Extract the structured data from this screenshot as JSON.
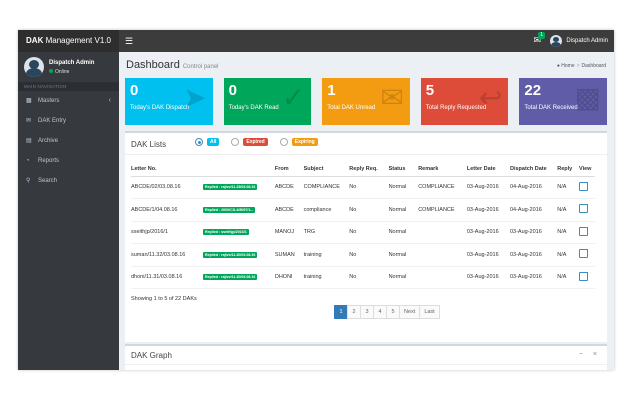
{
  "app": {
    "title_bold": "DAK",
    "title_rest": " Management V1.0"
  },
  "topbar": {
    "mail_count": "1",
    "user": "Dispatch Admin"
  },
  "sidebar": {
    "user_name": "Dispatch Admin",
    "status": "Online",
    "header": "MAIN NAVIGATION",
    "items": [
      {
        "label": "Masters",
        "icon": "dashboard-icon"
      },
      {
        "label": "DAK Entry",
        "icon": "envelope-icon"
      },
      {
        "label": "Archive",
        "icon": "archive-icon"
      },
      {
        "label": "Reports",
        "icon": "pie-chart-icon"
      },
      {
        "label": "Search",
        "icon": "search-icon"
      }
    ]
  },
  "page": {
    "title": "Dashboard",
    "subtitle": "Control panel",
    "breadcrumb_home": "Home",
    "breadcrumb_current": "Dashboard"
  },
  "stats": [
    {
      "value": "0",
      "label": "Today's DAK Dispatch",
      "color": "#00c0ef",
      "icon": "paper-plane-icon"
    },
    {
      "value": "0",
      "label": "Today's DAK Read",
      "color": "#00a65a",
      "icon": "check-icon"
    },
    {
      "value": "1",
      "label": "Total DAK Unread",
      "color": "#f39c12",
      "icon": "envelope-icon"
    },
    {
      "value": "5",
      "label": "Total Reply Requested",
      "color": "#dd4b39",
      "icon": "reply-icon"
    },
    {
      "value": "22",
      "label": "Total DAK Received",
      "color": "#605ca8",
      "icon": "chat-icon"
    }
  ],
  "lists": {
    "title": "DAK Lists",
    "filters": {
      "all": "All",
      "expired": "Expired",
      "expiring": "Expiring"
    },
    "columns": [
      "Letter No.",
      "From",
      "Subject",
      "Reply Req.",
      "Status",
      "Remark",
      "Letter Date",
      "Dispatch Date",
      "Reply",
      "View"
    ],
    "rows": [
      {
        "letter": "ABCDE/02/03.08.16",
        "replied": "Replied : rajive/11.25/03.08.16",
        "from": "ABCDE",
        "subject": "COMPLIANCE",
        "reply_req": "No",
        "status": "Normal",
        "remark": "COMPLIANCE",
        "letter_date": "03-Aug-2016",
        "dispatch_date": "04-Aug-2016",
        "reply": "N/A"
      },
      {
        "letter": "ABCDE/1/04.08.16",
        "replied": "Replied : 2000/CS-4/8097/1...",
        "from": "ABCDE",
        "subject": "compliance",
        "reply_req": "No",
        "status": "Normal",
        "remark": "COMPLIANCE",
        "letter_date": "03-Aug-2016",
        "dispatch_date": "04-Aug-2016",
        "reply": "N/A"
      },
      {
        "letter": "sseithjp/2016/1",
        "replied": "Replied : sseithjp/2016/1",
        "from": "MANOJ",
        "subject": "TRG",
        "reply_req": "No",
        "status": "Normal",
        "remark": "",
        "letter_date": "03-Aug-2016",
        "dispatch_date": "03-Aug-2016",
        "reply": "N/A"
      },
      {
        "letter": "suman/11.32/03.08.16",
        "replied": "Replied : rajive/11.30/03.08.16",
        "from": "SUMAN",
        "subject": "training",
        "reply_req": "No",
        "status": "Normal",
        "remark": "",
        "letter_date": "03-Aug-2016",
        "dispatch_date": "03-Aug-2016",
        "reply": "N/A"
      },
      {
        "letter": "dhoni/11.31/03.08.16",
        "replied": "Replied : rajive/11.30/03.08.16",
        "from": "DHONI",
        "subject": "training",
        "reply_req": "No",
        "status": "Normal",
        "remark": "",
        "letter_date": "03-Aug-2016",
        "dispatch_date": "03-Aug-2016",
        "reply": "N/A"
      }
    ],
    "showing": "Showing 1 to 5 of 22 DAKs",
    "pages": [
      "1",
      "2",
      "3",
      "4",
      "5",
      "Next",
      "Last"
    ]
  },
  "graph": {
    "title": "DAK Graph",
    "tools": "− ×"
  }
}
